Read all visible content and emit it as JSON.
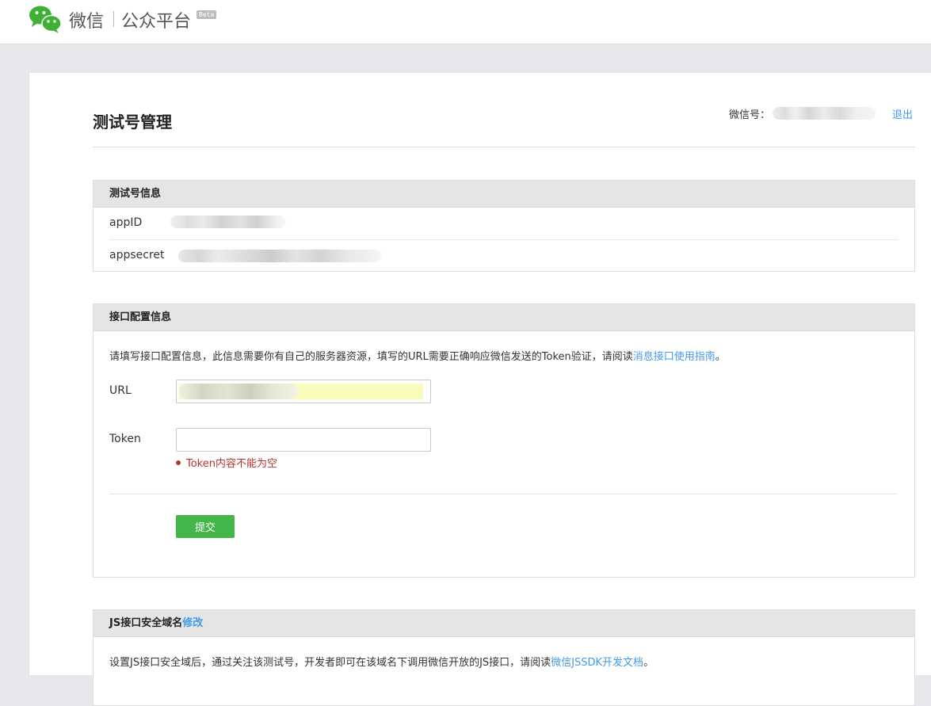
{
  "header": {
    "brand_name": "微信",
    "platform": "公众平台",
    "beta": "Beta"
  },
  "page": {
    "title": "测试号管理",
    "account_label": "微信号：",
    "logout": "退出"
  },
  "test_account": {
    "heading": "测试号信息",
    "rows": [
      {
        "label": "appID"
      },
      {
        "label": "appsecret"
      }
    ]
  },
  "interface_config": {
    "heading": "接口配置信息",
    "description": "请填写接口配置信息，此信息需要你有自己的服务器资源，填写的URL需要正确响应微信发送的Token验证，请阅读",
    "description_link": "消息接口使用指南",
    "description_end": "。",
    "url_label": "URL",
    "token_label": "Token",
    "token_value": "",
    "token_error": "Token内容不能为空",
    "submit": "提交"
  },
  "js_domain": {
    "heading": "JS接口安全域名",
    "edit": "修改",
    "description": "设置JS接口安全域后，通过关注该测试号，开发者即可在该域名下调用微信开放的JS接口，请阅读",
    "description_link": "微信JSSDK开发文档",
    "description_end": "。"
  },
  "colors": {
    "accent_link": "#459ae9",
    "primary_button": "#44b549",
    "error": "#b5342c",
    "url_autofill": "#fafcbb"
  }
}
